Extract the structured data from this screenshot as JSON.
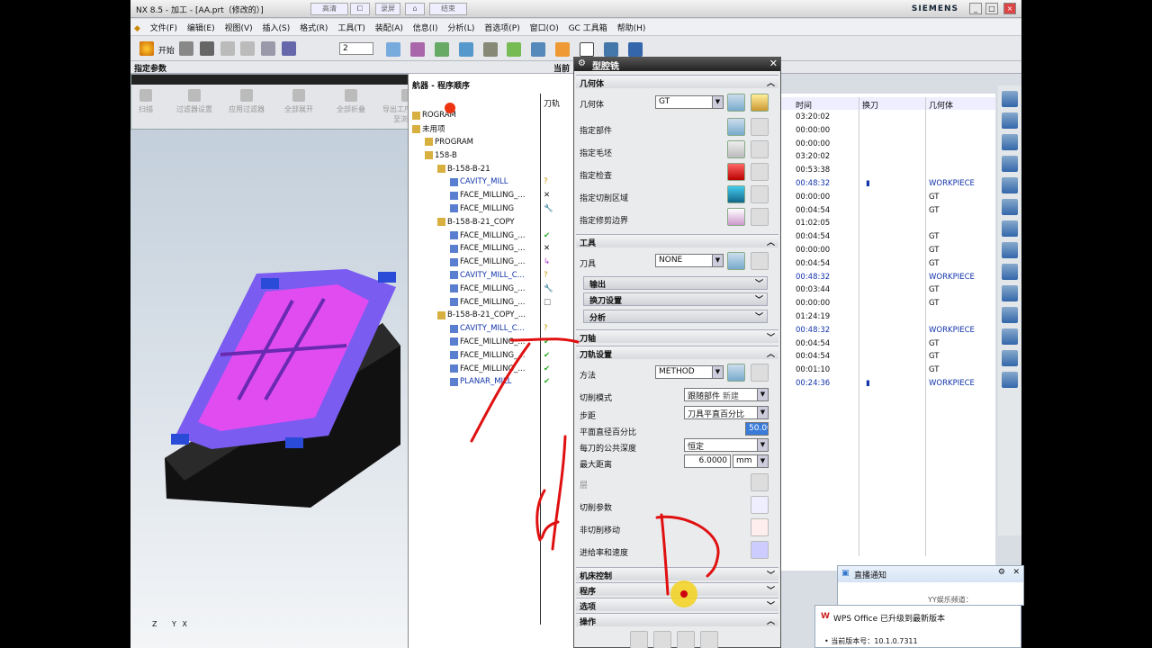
{
  "window": {
    "title": "NX 8.5 - 加工 - [AA.prt（修改的）]",
    "tabs": [
      "高清",
      "录屏",
      "结束"
    ],
    "brand": "SIEMENS",
    "controls": [
      "_",
      "□",
      "×"
    ]
  },
  "menubar": {
    "items": [
      "文件(F)",
      "编辑(E)",
      "视图(V)",
      "插入(S)",
      "格式(R)",
      "工具(T)",
      "装配(A)",
      "信息(I)",
      "分析(L)",
      "首选项(P)",
      "窗口(O)",
      "GC 工具箱",
      "帮助(H)"
    ]
  },
  "toolbar": {
    "start_label": "开始",
    "layer_value": "2"
  },
  "strip": {
    "left_label": "指定参数",
    "mid_label": "当前"
  },
  "filterbar": {
    "buttons": [
      "扫描",
      "过滤器设置",
      "应用过滤器",
      "全部展开",
      "全部折叠",
      "导出工序导航树至浏览器"
    ]
  },
  "navigator": {
    "title": "航器 - 程序顺序",
    "col_toolpath": "刀轨",
    "rows": [
      {
        "name": "ROGRAM",
        "indent": 0,
        "status": ""
      },
      {
        "name": "未用项",
        "indent": 0,
        "status": ""
      },
      {
        "name": "PROGRAM",
        "indent": 1,
        "status": ""
      },
      {
        "name": "158-B",
        "indent": 1,
        "status": ""
      },
      {
        "name": "B-158-B-21",
        "indent": 2,
        "status": ""
      },
      {
        "name": "CAVITY_MILL",
        "indent": 3,
        "status": "?"
      },
      {
        "name": "FACE_MILLING_...",
        "indent": 3,
        "status": "✕"
      },
      {
        "name": "FACE_MILLING",
        "indent": 3,
        "status": "🔧"
      },
      {
        "name": "B-158-B-21_COPY",
        "indent": 2,
        "status": ""
      },
      {
        "name": "FACE_MILLING_...",
        "indent": 3,
        "status": "✔"
      },
      {
        "name": "FACE_MILLING_...",
        "indent": 3,
        "status": "✕"
      },
      {
        "name": "FACE_MILLING_...",
        "indent": 3,
        "status": "↳"
      },
      {
        "name": "CAVITY_MILL_C...",
        "indent": 3,
        "status": "?"
      },
      {
        "name": "FACE_MILLING_...",
        "indent": 3,
        "status": "🔧"
      },
      {
        "name": "FACE_MILLING_...",
        "indent": 3,
        "status": "□"
      },
      {
        "name": "B-158-B-21_COPY_...",
        "indent": 2,
        "status": ""
      },
      {
        "name": "CAVITY_MILL_C...",
        "indent": 3,
        "status": "?"
      },
      {
        "name": "FACE_MILLING_...",
        "indent": 3,
        "status": "✔"
      },
      {
        "name": "FACE_MILLING_...",
        "indent": 3,
        "status": "✔"
      },
      {
        "name": "FACE_MILLING_...",
        "indent": 3,
        "status": "✔"
      },
      {
        "name": "PLANAR_MILL",
        "indent": 3,
        "status": "✔"
      }
    ]
  },
  "rightcols": {
    "headers": [
      "时间",
      "换刀",
      "几何体"
    ],
    "rows": [
      {
        "time": "03:20:02",
        "tool": "",
        "geom": ""
      },
      {
        "time": "00:00:00",
        "tool": "",
        "geom": ""
      },
      {
        "time": "00:00:00",
        "tool": "",
        "geom": ""
      },
      {
        "time": "03:20:02",
        "tool": "",
        "geom": ""
      },
      {
        "time": "00:53:38",
        "tool": "",
        "geom": ""
      },
      {
        "time": "00:48:32",
        "tool": "▮",
        "geom": "WORKPIECE"
      },
      {
        "time": "00:00:00",
        "tool": "",
        "geom": "GT"
      },
      {
        "time": "00:04:54",
        "tool": "",
        "geom": "GT"
      },
      {
        "time": "01:02:05",
        "tool": "",
        "geom": ""
      },
      {
        "time": "00:04:54",
        "tool": "",
        "geom": "GT"
      },
      {
        "time": "00:00:00",
        "tool": "",
        "geom": "GT"
      },
      {
        "time": "00:04:54",
        "tool": "",
        "geom": "GT"
      },
      {
        "time": "00:48:32",
        "tool": "",
        "geom": "WORKPIECE"
      },
      {
        "time": "00:03:44",
        "tool": "",
        "geom": "GT"
      },
      {
        "time": "00:00:00",
        "tool": "",
        "geom": "GT"
      },
      {
        "time": "01:24:19",
        "tool": "",
        "geom": ""
      },
      {
        "time": "00:48:32",
        "tool": "",
        "geom": "WORKPIECE"
      },
      {
        "time": "00:04:54",
        "tool": "",
        "geom": "GT"
      },
      {
        "time": "00:04:54",
        "tool": "",
        "geom": "GT"
      },
      {
        "time": "00:01:10",
        "tool": "",
        "geom": "GT"
      },
      {
        "time": "00:24:36",
        "tool": "▮",
        "geom": "WORKPIECE"
      }
    ]
  },
  "dialog": {
    "title": "型腔铣",
    "geometry": {
      "section": "几何体",
      "geom_label": "几何体",
      "geom_value": "GT",
      "items": [
        "指定部件",
        "指定毛坯",
        "指定检查",
        "指定切削区域",
        "指定修剪边界"
      ]
    },
    "tool": {
      "section": "工具",
      "tool_label": "刀具",
      "tool_value": "NONE",
      "subs": [
        "输出",
        "换刀设置",
        "分析"
      ]
    },
    "axis": {
      "section": "刀轴"
    },
    "toolpath": {
      "section": "刀轨设置",
      "method_label": "方法",
      "method_value": "METHOD",
      "cut_mode_label": "切削模式",
      "cut_mode_value": "跟随部件",
      "cut_mode_extra": "新建",
      "stepover_label": "步距",
      "stepover_value": "刀具平直百分比",
      "pct_label": "平面直径百分比",
      "pct_value": "50.0000",
      "depth_label": "每刀的公共深度",
      "depth_value": "恒定",
      "maxdist_label": "最大距离",
      "maxdist_value": "6.0000",
      "maxdist_unit": "mm",
      "layer_label": "层",
      "cut_params": "切削参数",
      "non_cut": "非切削移动",
      "feeds": "进给率和速度"
    },
    "collapsed": [
      "机床控制",
      "程序",
      "选项",
      "操作"
    ]
  },
  "notification": {
    "title": "直播通知",
    "body": "YY娱乐频道：",
    "wps_title": "WPS Office 已升级到最新版本",
    "wps_version": "当前版本号：10.1.0.7311"
  },
  "axes": {
    "z": "Z",
    "y": "Y",
    "x": "X"
  },
  "colors": {
    "accent_blue": "#1133aa",
    "ink_red": "#e01010",
    "part_magenta": "#e04cf0",
    "part_purple": "#7a5cf0"
  }
}
